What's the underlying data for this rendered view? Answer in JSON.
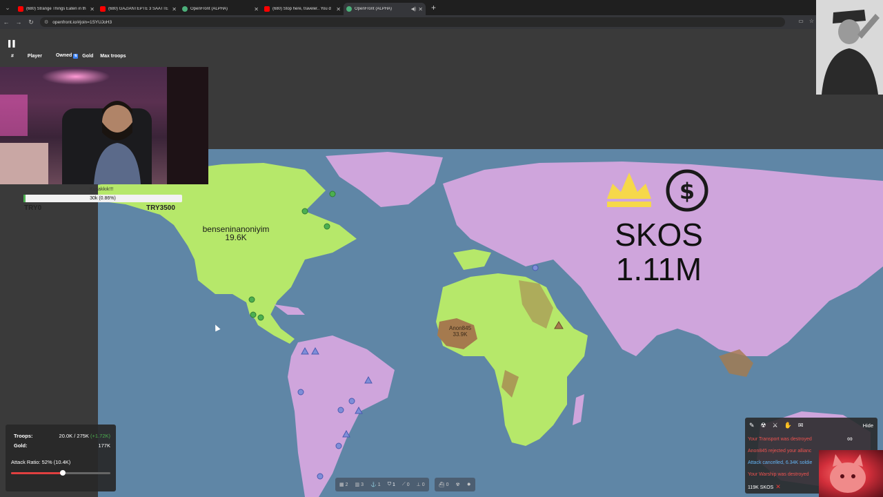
{
  "browser": {
    "tabs": [
      {
        "title": "(680) Strange Things Eaten in th",
        "icon": "youtube-icon",
        "active": false
      },
      {
        "title": "(680) GAZİANTEPTE 3 SAATTE",
        "icon": "youtube-icon",
        "active": false
      },
      {
        "title": "OpenFront (ALPHA)",
        "icon": "openfront-icon",
        "active": false
      },
      {
        "title": "(680) Stop here, traveler.. You d",
        "icon": "youtube-icon",
        "active": false
      },
      {
        "title": "OpenFront (ALPHA)",
        "icon": "openfront-icon",
        "active": true
      }
    ],
    "url": "openfront.io/#join=1SYUJoH3"
  },
  "leaderboard": {
    "headers": [
      "#",
      "Player",
      "Owned",
      "Gold",
      "Max troops"
    ]
  },
  "player_panel": {
    "name": "Kuşakkık!!!",
    "bar_text": "30k (0.86%)",
    "bar_fill_fraction": 0.0086,
    "try_left": "TRY0",
    "try_right": "TRY3500"
  },
  "map": {
    "labels": {
      "north_america_name": "benseninanoniyim",
      "north_america_troops": "19.6K",
      "africa_name": "Anon845",
      "africa_troops": "33.9K",
      "leader_name": "SKOS",
      "leader_value": "1.11M"
    },
    "colors": {
      "ocean": "#5f86a6",
      "player_green": "#b6e86a",
      "skos_purple": "#cfa5dc",
      "anon_brown": "#a57a4e"
    }
  },
  "stats": {
    "troops_label": "Troops:",
    "troops_value": "20.0K / 275K",
    "troops_delta": "(+1.72K)",
    "gold_label": "Gold:",
    "gold_value": "177K",
    "attack_ratio": "Attack Ratio: 52% (10.4K)",
    "attack_ratio_fraction": 0.52
  },
  "toolbar": {
    "items": [
      {
        "icon": "city-icon",
        "count": "2"
      },
      {
        "icon": "factory-icon",
        "count": "3"
      },
      {
        "icon": "port-icon",
        "count": "1"
      },
      {
        "icon": "defense-post-icon",
        "count": "1"
      },
      {
        "icon": "missile-silo-icon",
        "count": "0"
      },
      {
        "icon": "sam-launcher-icon",
        "count": "0"
      },
      {
        "icon": "warship-icon",
        "count": "0"
      },
      {
        "icon": "nuke-icon",
        "count": ""
      },
      {
        "icon": "hydrogen-bomb-icon",
        "count": ""
      }
    ]
  },
  "events": {
    "hide_label": "Hide",
    "messages": [
      {
        "text": "Your Transport was destroyed",
        "color": "red"
      },
      {
        "text": "Anon845 rejected your allianc",
        "color": "red"
      },
      {
        "text": "Attack cancelled, 6.34K soldie",
        "color": "blue"
      },
      {
        "text": "Your Warship was destroyed",
        "color": "red"
      },
      {
        "text": "119K SKOS",
        "color": "white"
      }
    ]
  }
}
